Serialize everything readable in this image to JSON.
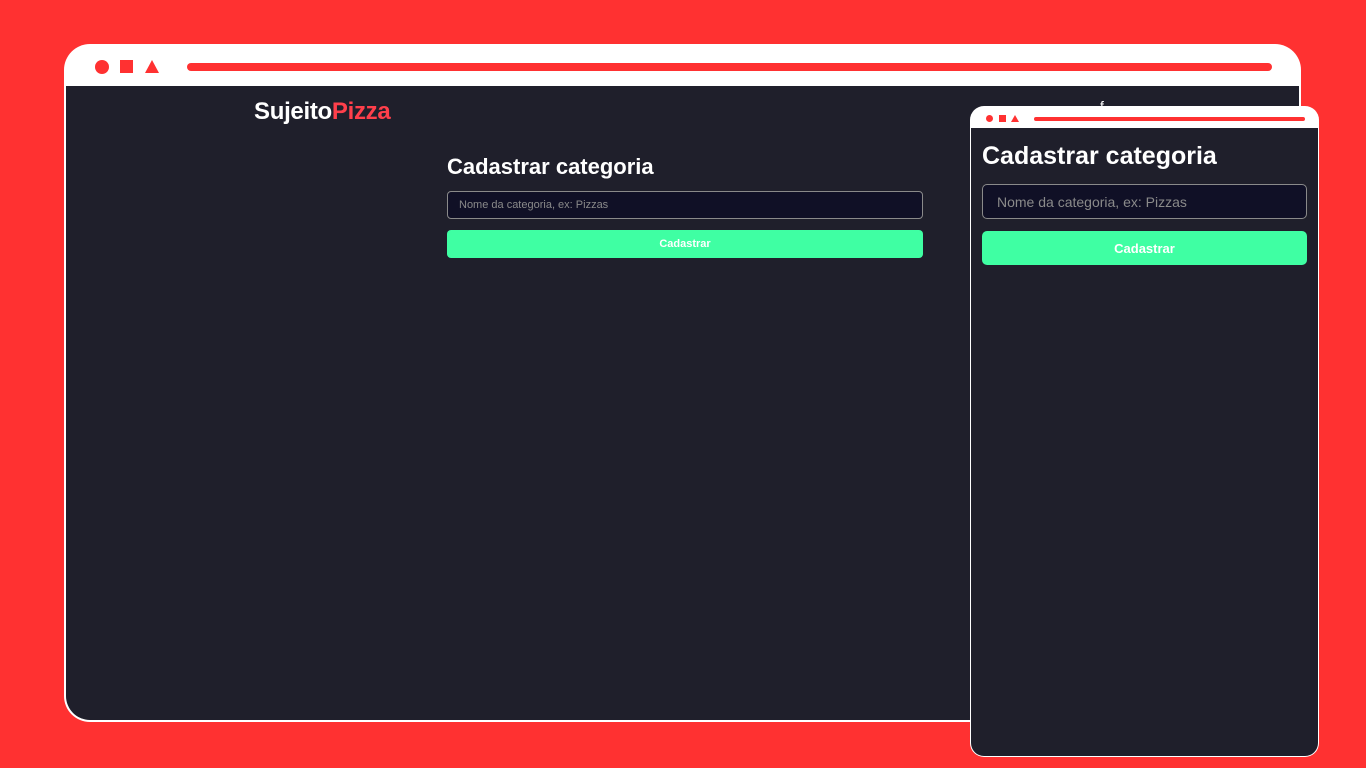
{
  "colors": {
    "background": "#ff3131",
    "chrome": "#ffffff",
    "chrome_accent": "#ff3131",
    "app_background": "#1f1f2b",
    "input_background": "#101026",
    "input_border": "#8a8a8a",
    "button": "#3fffa3",
    "logo_accent": "#ff3f4b"
  },
  "chrome_icons": [
    "circle-icon",
    "square-icon",
    "triangle-icon"
  ],
  "desktop": {
    "header": {
      "logo_white": "Sujeito",
      "logo_red": "Pizza",
      "nav_fragment": "f"
    },
    "form": {
      "title": "Cadastrar categoria",
      "input_placeholder": "Nome da categoria, ex: Pizzas",
      "input_value": "",
      "button_label": "Cadastrar"
    }
  },
  "mobile": {
    "form": {
      "title": "Cadastrar categoria",
      "input_placeholder": "Nome da categoria, ex: Pizzas",
      "input_value": "",
      "button_label": "Cadastrar"
    }
  }
}
